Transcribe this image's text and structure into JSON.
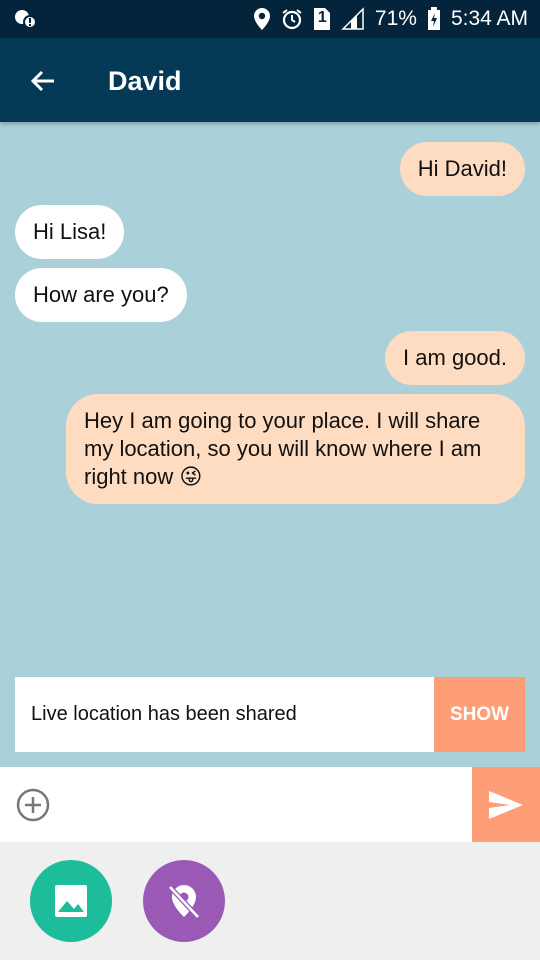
{
  "status_bar": {
    "battery": "71%",
    "time": "5:34 AM",
    "sim_slot": "1",
    "icons": [
      "notification-icon",
      "location-icon",
      "alarm-icon",
      "sim-icon",
      "signal-icon",
      "battery-icon"
    ]
  },
  "header": {
    "title": "David",
    "back_icon": "arrow-back-icon"
  },
  "messages": [
    {
      "direction": "out",
      "text": "Hi David!"
    },
    {
      "direction": "in",
      "text": "Hi Lisa!"
    },
    {
      "direction": "in",
      "text": "How are you?"
    },
    {
      "direction": "out",
      "text": "I am good."
    },
    {
      "direction": "out",
      "text": "Hey I am going to your place. I will share my location, so you will know where I am right now",
      "emoji": "😜"
    }
  ],
  "banner": {
    "text": "Live location has been shared",
    "action_label": "SHOW"
  },
  "composer": {
    "placeholder": "",
    "value": "",
    "add_icon": "add-circle-icon",
    "send_icon": "send-icon"
  },
  "attachments": [
    {
      "name": "image",
      "icon": "image-icon",
      "color": "#1dbc9b"
    },
    {
      "name": "location-off",
      "icon": "location-off-icon",
      "color": "#9b59b6"
    }
  ],
  "colors": {
    "status_bar": "#04243b",
    "app_bar": "#043a56",
    "chat_bg": "#aad1da",
    "incoming_bubble": "#ffffff",
    "outgoing_bubble": "#fedcc2",
    "accent": "#fe9e76",
    "tray_bg": "#efefef"
  }
}
